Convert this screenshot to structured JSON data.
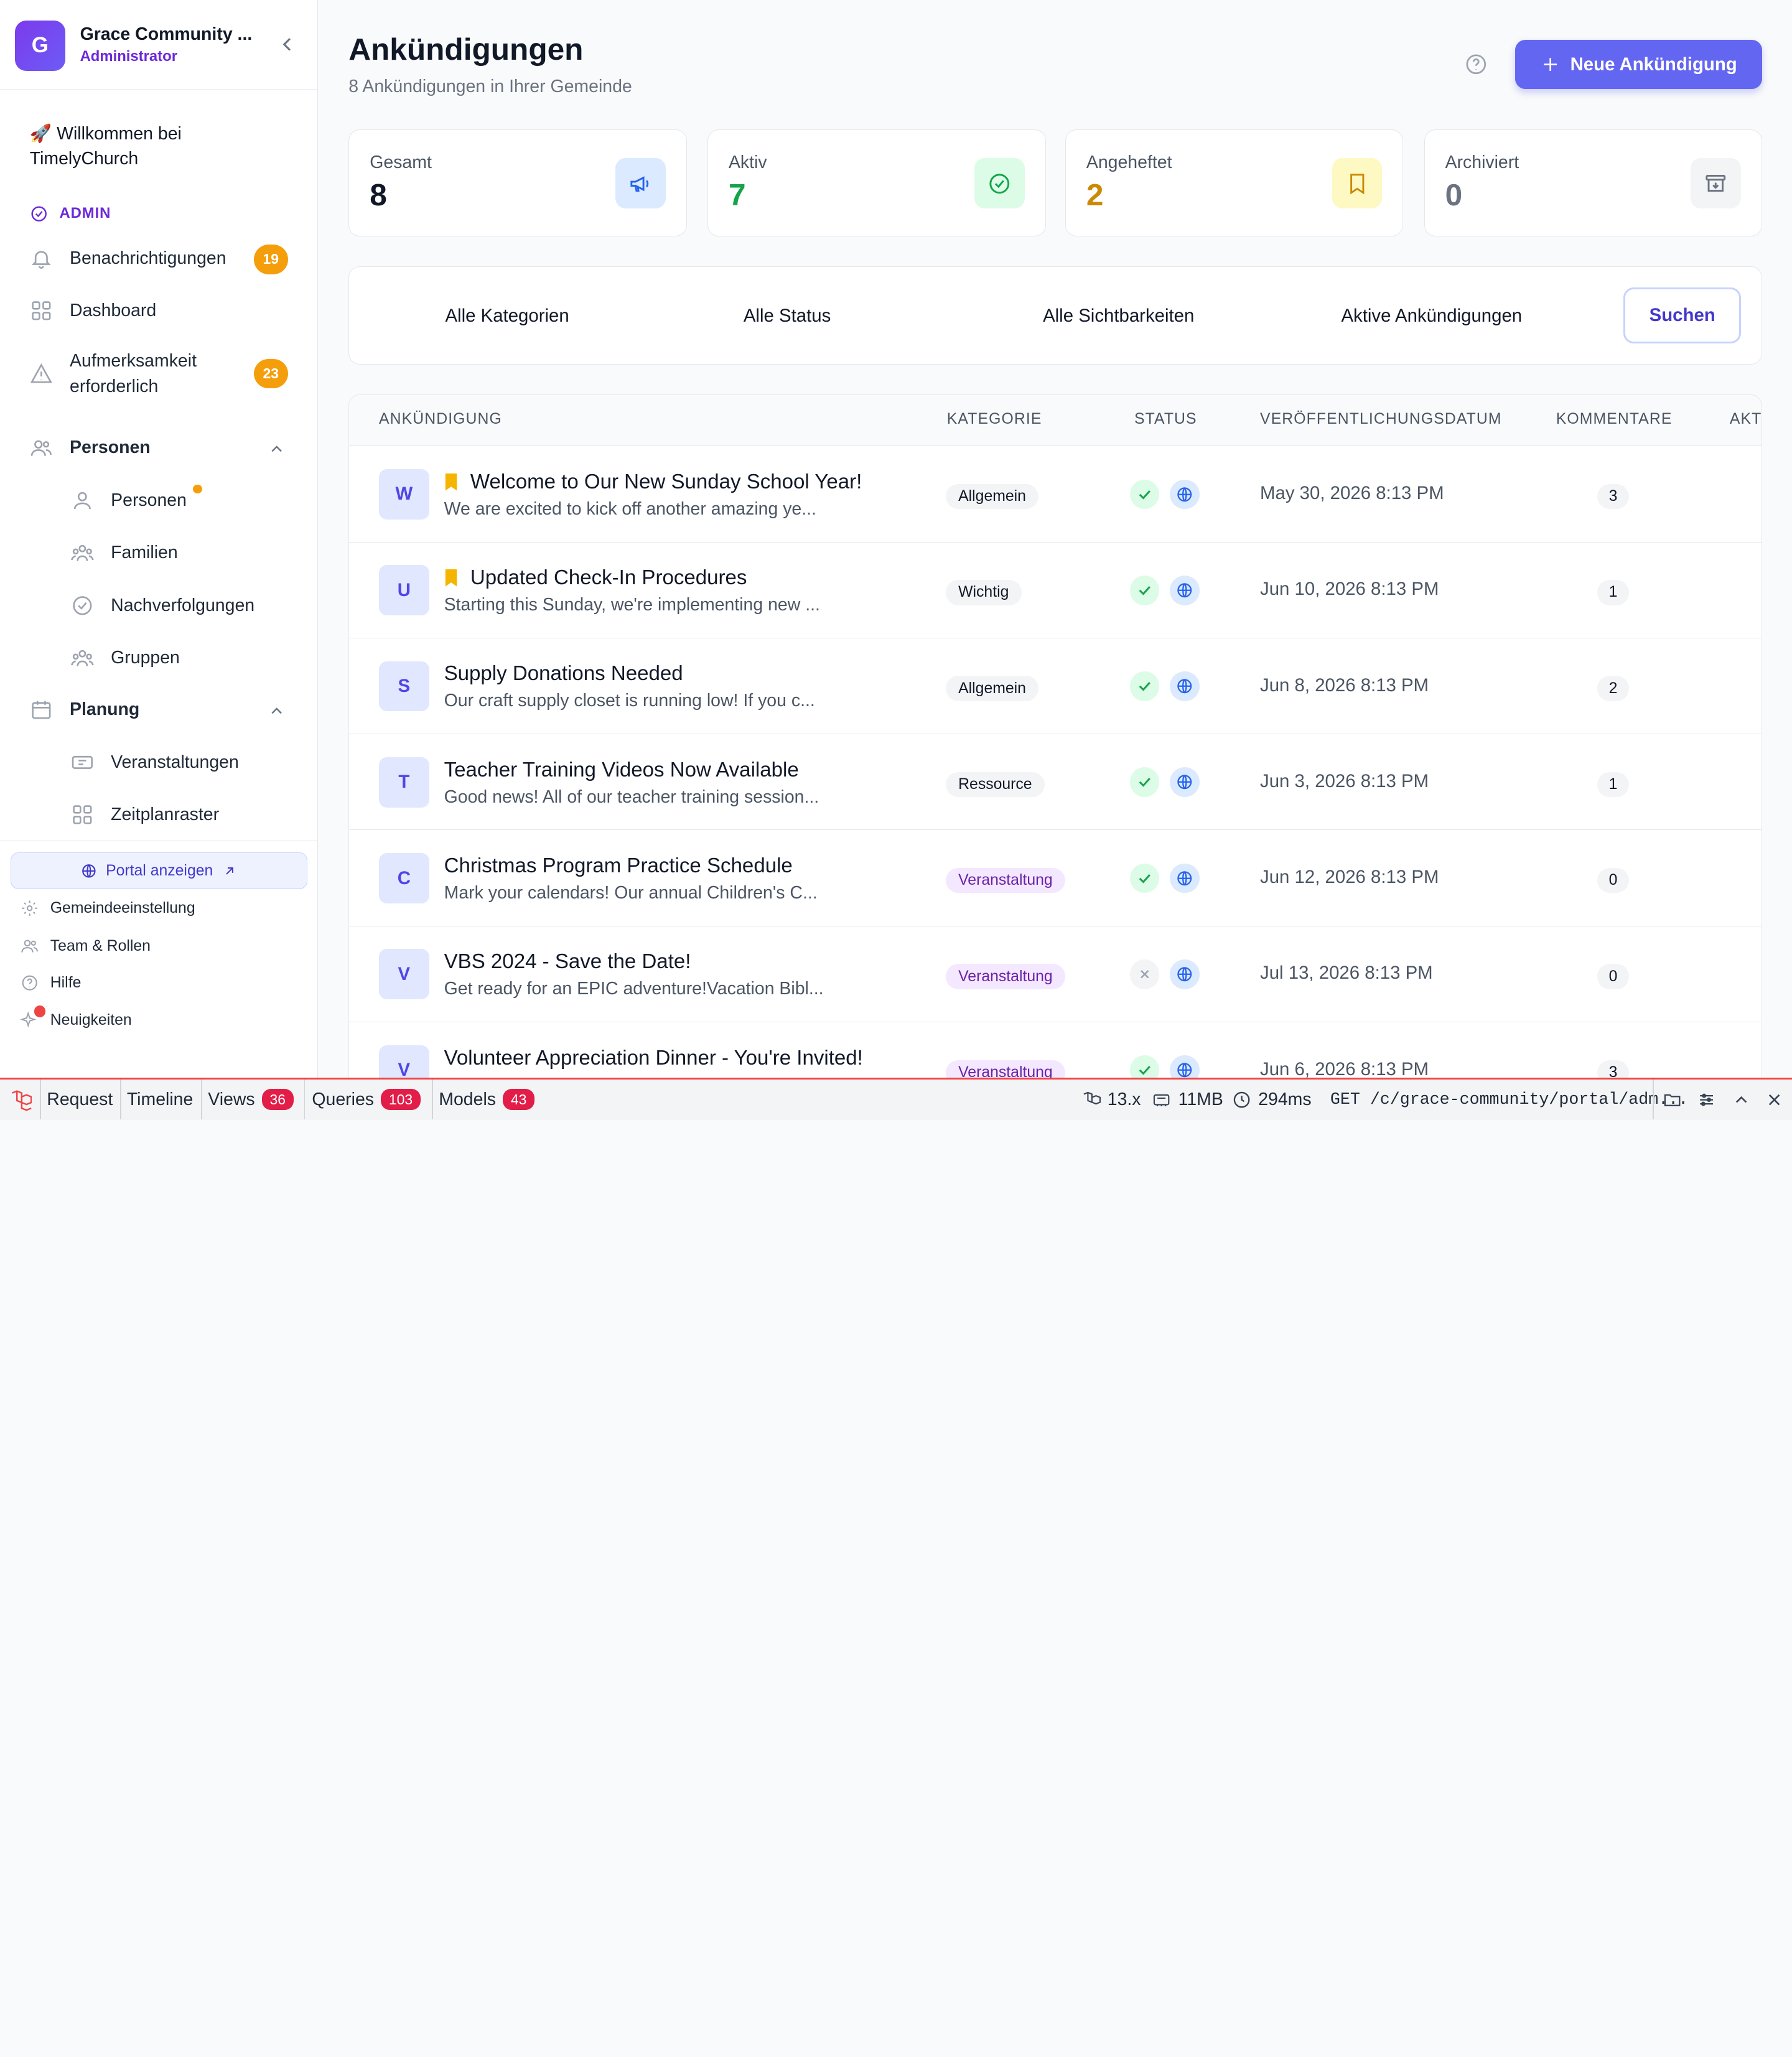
{
  "sidebar": {
    "logo_letter": "G",
    "org_name": "Grace Community ...",
    "role": "Administrator",
    "welcome": "🚀 Willkommen bei TimelyChurch",
    "admin_label": "ADMIN",
    "items": [
      {
        "label": "Benachrichtigungen",
        "badge": "19",
        "icon": "bell-icon"
      },
      {
        "label": "Dashboard",
        "icon": "grid-icon"
      },
      {
        "label": "Aufmerksamkeit erforderlich",
        "badge": "23",
        "icon": "alert-triangle-icon"
      },
      {
        "label": "Personen",
        "icon": "users-icon"
      },
      {
        "label": "Personen",
        "icon": "user-icon"
      },
      {
        "label": "Familien",
        "icon": "family-icon"
      },
      {
        "label": "Nachverfolgungen",
        "icon": "check-circle-icon"
      },
      {
        "label": "Gruppen",
        "icon": "groups-icon"
      },
      {
        "label": "Planung",
        "icon": "calendar-icon"
      },
      {
        "label": "Veranstaltungen",
        "icon": "ticket-icon"
      },
      {
        "label": "Zeitplanraster",
        "icon": "grid-icon"
      }
    ],
    "portal_label": "Portal anzeigen",
    "links": [
      "Gemeindeeinstellung",
      "Team & Rollen",
      "Hilfe",
      "Neuigkeiten"
    ]
  },
  "header": {
    "title": "Ankündigungen",
    "subtitle": "8 Ankündigungen in Ihrer Gemeinde",
    "new_button": "Neue Ankündigung"
  },
  "stats": [
    {
      "label": "Gesamt",
      "value": "8",
      "color": "#111827",
      "icon": "megaphone-icon"
    },
    {
      "label": "Aktiv",
      "value": "7",
      "color": "#16a34a",
      "icon": "check-circle-icon"
    },
    {
      "label": "Angeheftet",
      "value": "2",
      "color": "#ca8a04",
      "icon": "bookmark-icon"
    },
    {
      "label": "Archiviert",
      "value": "0",
      "color": "#6b7280",
      "icon": "archive-icon"
    }
  ],
  "filters": {
    "category": "Alle Kategorien",
    "status": "Alle Status",
    "visibility": "Alle Sichtbarkeiten",
    "active": "Aktive Ankündigungen",
    "search": "Suchen"
  },
  "table": {
    "columns": [
      "ANKÜNDIGUNG",
      "KATEGORIE",
      "STATUS",
      "VERÖFFENTLICHUNGSDATUM",
      "KOMMENTARE",
      "AKT"
    ],
    "rows": [
      {
        "letter": "W",
        "pinned": true,
        "title": "Welcome to Our New Sunday School Year!",
        "desc": "We are excited to kick off another amazing ye...",
        "category": "Allgemein",
        "active": true,
        "date": "May 30, 2026 8:13 PM",
        "comments": "3"
      },
      {
        "letter": "U",
        "pinned": true,
        "title": "Updated Check-In Procedures",
        "desc": "Starting this Sunday, we're implementing new ...",
        "category": "Wichtig",
        "active": true,
        "date": "Jun 10, 2026 8:13 PM",
        "comments": "1"
      },
      {
        "letter": "S",
        "pinned": false,
        "title": "Supply Donations Needed",
        "desc": "Our craft supply closet is running low! If you c...",
        "category": "Allgemein",
        "active": true,
        "date": "Jun 8, 2026 8:13 PM",
        "comments": "2"
      },
      {
        "letter": "T",
        "pinned": false,
        "title": "Teacher Training Videos Now Available",
        "desc": "Good news! All of our teacher training session...",
        "category": "Ressource",
        "active": true,
        "date": "Jun 3, 2026 8:13 PM",
        "comments": "1"
      },
      {
        "letter": "C",
        "pinned": false,
        "title": "Christmas Program Practice Schedule",
        "desc": "Mark your calendars! Our annual Children's C...",
        "category": "Veranstaltung",
        "active": true,
        "date": "Jun 12, 2026 8:13 PM",
        "comments": "0"
      },
      {
        "letter": "V",
        "pinned": false,
        "title": "VBS 2024 - Save the Date!",
        "desc": "Get ready for an EPIC adventure!Vacation Bibl...",
        "category": "Veranstaltung",
        "active": false,
        "date": "Jul 13, 2026 8:13 PM",
        "comments": "0"
      },
      {
        "letter": "V",
        "pinned": false,
        "title": "Volunteer Appreciation Dinner - You're Invited!",
        "desc": "",
        "category": "Veranstaltung",
        "active": true,
        "date": "Jun 6, 2026 8:13 PM",
        "comments": "3"
      }
    ]
  },
  "debugbar": {
    "request": "Request",
    "timeline": "Timeline",
    "views": "Views",
    "views_count": "36",
    "queries": "Queries",
    "queries_count": "103",
    "models": "Models",
    "models_count": "43",
    "php": "13.x",
    "memory": "11MB",
    "time": "294ms",
    "route": "GET /c/grace-community/portal/adm..."
  },
  "colors": {
    "accent": "#6366f1",
    "brand": "#7c3aed",
    "debug_red": "#ef4444"
  }
}
